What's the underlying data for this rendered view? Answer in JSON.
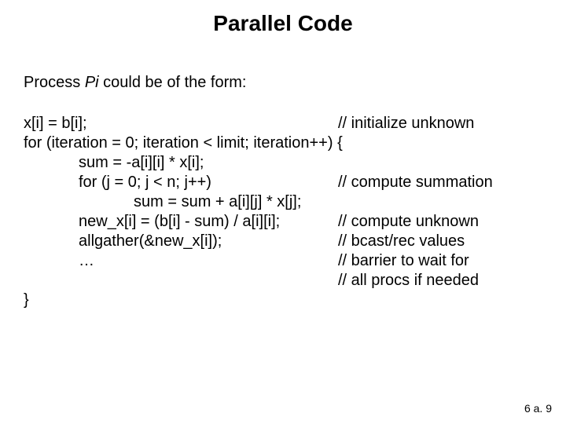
{
  "title": "Parallel Code",
  "intro": {
    "prefix": "Process ",
    "pi": "Pi",
    "suffix": " could be of the form:"
  },
  "code": {
    "l1a": "x[i] = b[i];",
    "l1c": "// initialize unknown",
    "l2": "for (iteration = 0; iteration < limit; iteration++) {",
    "l3": "sum = -a[i][i] * x[i];",
    "l4a": "for (j = 0; j < n; j++)",
    "l4c": "// compute summation",
    "l5": "sum = sum + a[i][j] * x[j];",
    "l6a": "new_x[i] = (b[i] - sum) / a[i][i];",
    "l6c": "// compute unknown",
    "l7a": "allgather(&new_x[i]);",
    "l7c": "// bcast/rec values",
    "l8a": "…",
    "l8c": "// barrier to wait for",
    "l9c": "// all procs if needed",
    "l10": "}"
  },
  "footer": "6 a. 9"
}
